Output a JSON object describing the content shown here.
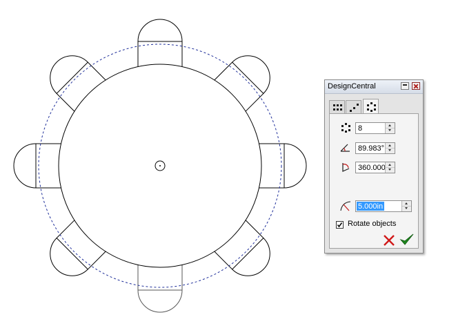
{
  "dialog": {
    "title": "DesignCentral",
    "tabs": [
      {
        "icon": "grid-array-icon",
        "active": false
      },
      {
        "icon": "path-array-icon",
        "active": false
      },
      {
        "icon": "polar-array-icon",
        "active": true
      }
    ],
    "count": {
      "icon": "item-count-icon",
      "value": "8"
    },
    "angle": {
      "icon": "angle-between-icon",
      "value": "89.983°"
    },
    "fill_angle": {
      "icon": "fill-angle-icon",
      "value": "360.000"
    },
    "radius": {
      "icon": "radius-icon",
      "value": "5.000in",
      "selected": true
    },
    "rotate": {
      "label": "Rotate objects",
      "checked": true
    },
    "cancel_icon": "red-x-icon",
    "ok_icon": "green-check-icon"
  },
  "drawing": {
    "chair_count": 8,
    "line_color": "#000000",
    "preview_color": "#1f2f9a"
  }
}
